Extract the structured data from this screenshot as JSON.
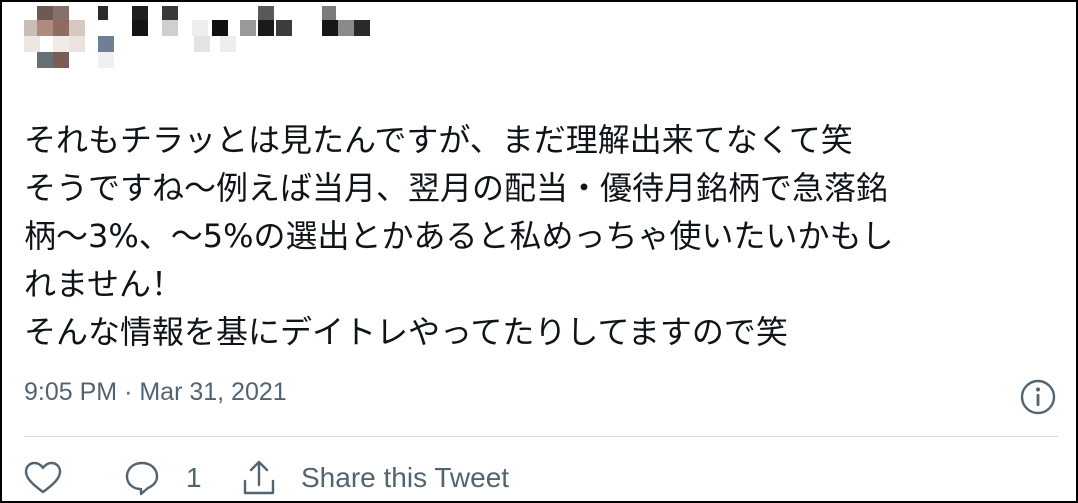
{
  "tweet": {
    "lines": [
      "それもチラッとは見たんですが、まだ理解出来てなくて笑",
      "そうですね〜例えば当月、翌月の配当・優待月銘柄で急落銘",
      "柄〜3%、〜5%の選出とかあると私めっちゃ使いたいかもし",
      "れません！",
      "そんな情報を基にデイトレやってたりしてますので笑"
    ],
    "time": "9:05 PM",
    "separator": "·",
    "date": "Mar 31, 2021"
  },
  "actions": {
    "like_icon": "heart-icon",
    "reply_icon": "reply-bubble-icon",
    "reply_count": "1",
    "share_icon": "share-icon",
    "share_label": "Share this Tweet"
  },
  "header": {
    "avatar": "pixelated-avatar",
    "name": "pixelated-username"
  },
  "colors": {
    "text": "#0f1419",
    "secondary": "#536471",
    "divider": "#cfd9de"
  }
}
